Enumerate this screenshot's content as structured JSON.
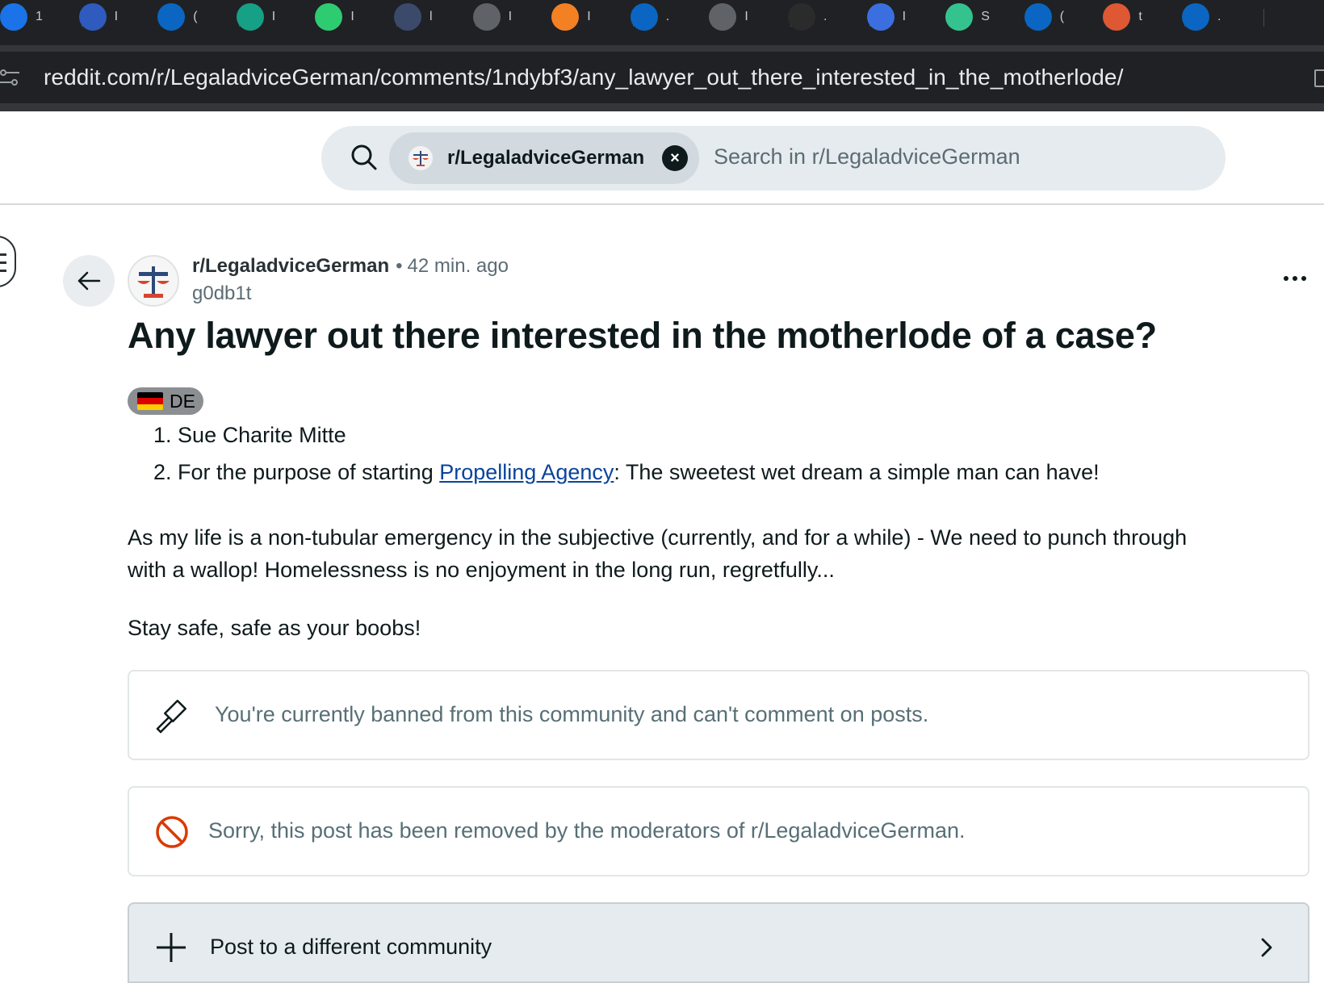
{
  "browser": {
    "tabs": [
      {
        "icon": "refresh-blue-icon",
        "title": "1",
        "color": "#1a73e8"
      },
      {
        "icon": "link-blue-icon",
        "title": "I",
        "color": "#2e5bbd"
      },
      {
        "icon": "linkedin-icon",
        "title": "(",
        "color": "#0a66c2"
      },
      {
        "icon": "check-diamond-icon",
        "title": "I",
        "color": "#16a085"
      },
      {
        "icon": "k-letter-icon",
        "title": "I",
        "color": "#2ecc71"
      },
      {
        "icon": "mountain-icon",
        "title": "l",
        "color": "#3b4a6b"
      },
      {
        "icon": "globe-icon",
        "title": "I",
        "color": "#5f6368"
      },
      {
        "icon": "stack-icon",
        "title": "I",
        "color": "#f48024"
      },
      {
        "icon": "linkedin-round-icon",
        "title": ".",
        "color": "#0a66c2"
      },
      {
        "icon": "globe-icon",
        "title": "I",
        "color": "#5f6368"
      },
      {
        "icon": "mountain-white-icon",
        "title": ".",
        "color": "#2b2b2b"
      },
      {
        "icon": "sun-icon",
        "title": "I",
        "color": "#3b6fe0"
      },
      {
        "icon": "s-green-icon",
        "title": "S",
        "color": "#34c38f"
      },
      {
        "icon": "linkedin-icon",
        "title": "(",
        "color": "#0a66c2"
      },
      {
        "icon": "duck-icon",
        "title": "t",
        "color": "#de5833"
      },
      {
        "icon": "linkedin-icon",
        "title": ".",
        "color": "#0a66c2"
      }
    ],
    "url": "reddit.com/r/LegaladviceGerman/comments/1ndybf3/any_lawyer_out_there_interested_in_the_motherlode/"
  },
  "search": {
    "community_chip": "r/LegaladviceGerman",
    "clear_symbol": "×",
    "placeholder": "Search in r/LegaladviceGerman"
  },
  "post": {
    "subreddit": "r/LegaladviceGerman",
    "separator": "•",
    "time": "42 min. ago",
    "author": "g0db1t",
    "title": "Any lawyer out there interested in the motherlode of a case?",
    "flair": "DE",
    "list": [
      {
        "number": "1.",
        "text": "Sue Charite Mitte"
      },
      {
        "number": "2.",
        "prefix": "For the purpose of starting ",
        "link": "Propelling Agency",
        "suffix": ": The sweetest wet dream a simple man can have!"
      }
    ],
    "paragraph1_line1": "As my life is a non-tubular emergency in the subjective (currently, and for a while) - We need to punch through",
    "paragraph1_line2": "with a wallop! Homelessness is no enjoyment in the long run, regretfully...",
    "paragraph2": "Stay safe, safe as your boobs!"
  },
  "notices": {
    "banned": "You're currently banned from this community and can't comment on posts.",
    "removed": "Sorry, this post has been removed by the moderators of r/LegaladviceGerman."
  },
  "actions": {
    "post_elsewhere": "Post to a different community"
  },
  "colors": {
    "removed_icon": "#d93a00",
    "link": "#0a449b",
    "flag_black": "#000000",
    "flag_red": "#dd0000",
    "flag_gold": "#ffce00"
  }
}
